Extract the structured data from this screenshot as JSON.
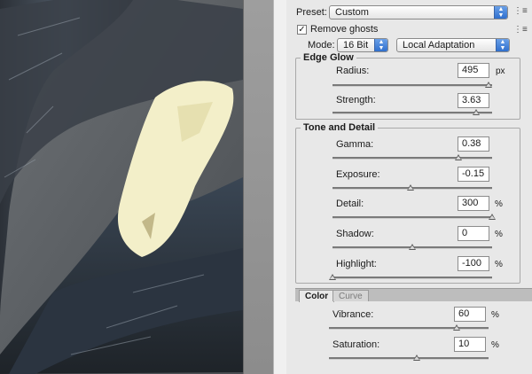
{
  "colors": {
    "accent": "#3b75d1",
    "panel": "#e8e8e8"
  },
  "preset": {
    "label": "Preset:",
    "value": "Custom"
  },
  "remove_ghosts": {
    "label": "Remove ghosts",
    "checked": true
  },
  "mode": {
    "label": "Mode:",
    "bit_depth": "16 Bit",
    "method": "Local Adaptation"
  },
  "edge_glow": {
    "title": "Edge Glow",
    "radius": {
      "label": "Radius:",
      "value": "495",
      "unit": "px",
      "level": 0.98
    },
    "strength": {
      "label": "Strength:",
      "value": "3.63",
      "level": 0.9
    }
  },
  "tone_detail": {
    "title": "Tone and Detail",
    "gamma": {
      "label": "Gamma:",
      "value": "0.38",
      "level": 0.79
    },
    "exposure": {
      "label": "Exposure:",
      "value": "-0.15",
      "level": 0.49
    },
    "detail": {
      "label": "Detail:",
      "value": "300",
      "unit": "%",
      "level": 1.0
    },
    "shadow": {
      "label": "Shadow:",
      "value": "0",
      "unit": "%",
      "level": 0.5
    },
    "highlight": {
      "label": "Highlight:",
      "value": "-100",
      "unit": "%",
      "level": 0.0
    }
  },
  "tabs": {
    "color": "Color",
    "curve": "Curve"
  },
  "color": {
    "vibrance": {
      "label": "Vibrance:",
      "value": "60",
      "unit": "%",
      "level": 0.8
    },
    "saturation": {
      "label": "Saturation:",
      "value": "10",
      "unit": "%",
      "level": 0.55
    }
  }
}
